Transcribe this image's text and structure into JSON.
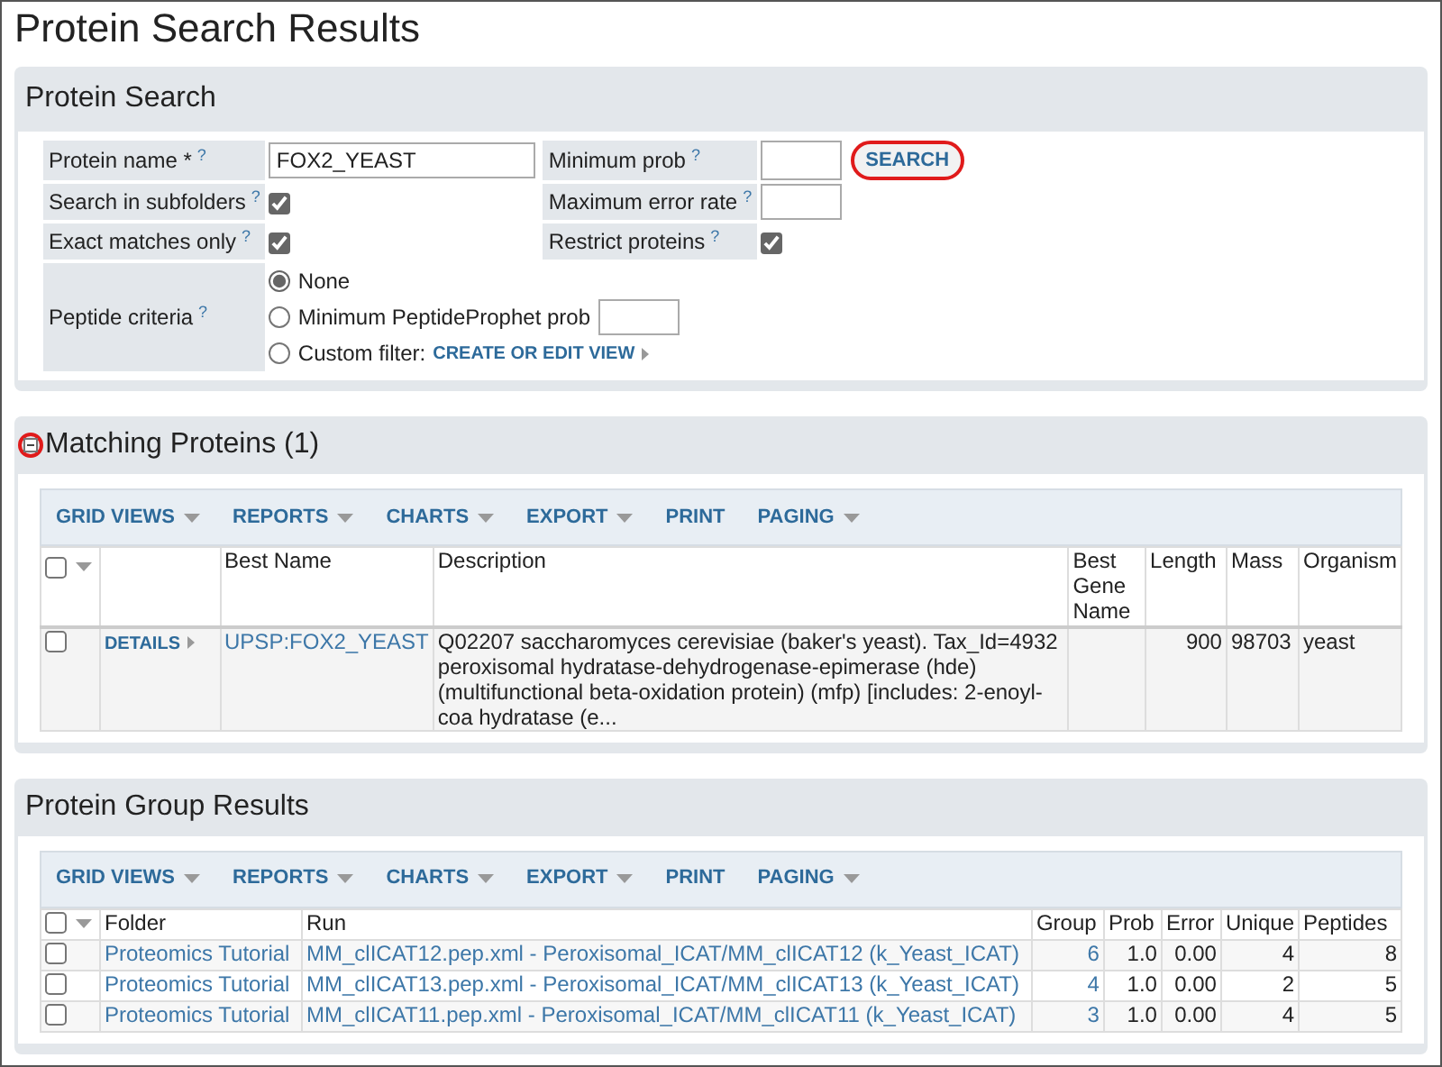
{
  "page_title": "Protein Search Results",
  "protein_search": {
    "title": "Protein Search",
    "protein_name": {
      "label": "Protein name *",
      "help": "?",
      "value": "FOX2_YEAST"
    },
    "minimum_prob": {
      "label": "Minimum prob",
      "help": "?"
    },
    "search_button": {
      "label": "SEARCH",
      "highlighted": true
    },
    "search_in_subfolders": {
      "label": "Search in subfolders",
      "help": "?",
      "checked": true
    },
    "maximum_error_rate": {
      "label": "Maximum error rate",
      "help": "?"
    },
    "exact_matches_only": {
      "label": "Exact matches only",
      "help": "?",
      "checked": true
    },
    "restrict_proteins": {
      "label": "Restrict proteins",
      "help": "?",
      "checked": true
    },
    "peptide_criteria": {
      "label": "Peptide criteria",
      "help": "?",
      "options": [
        {
          "kind": "plain",
          "label": "None",
          "selected": true
        },
        {
          "kind": "input",
          "label": "Minimum PeptideProphet prob",
          "selected": false
        },
        {
          "kind": "link",
          "label": "Custom filter:",
          "link": "CREATE OR EDIT VIEW",
          "selected": false
        }
      ]
    }
  },
  "matching_proteins": {
    "title": "Matching Proteins (1)",
    "collapse_highlighted": true,
    "header_checked": false,
    "toolbar": [
      {
        "label": "GRID VIEWS",
        "has_menu": true
      },
      {
        "label": "REPORTS",
        "has_menu": true
      },
      {
        "label": "CHARTS",
        "has_menu": true
      },
      {
        "label": "EXPORT",
        "has_menu": true
      },
      {
        "label": "PRINT",
        "has_menu": false
      },
      {
        "label": "PAGING",
        "has_menu": true
      }
    ],
    "columns": [
      "Best Name",
      "Description",
      "Best Gene Name",
      "Length",
      "Mass",
      "Organism"
    ],
    "rows": [
      {
        "checked": false,
        "details": "DETAILS",
        "best_name": "UPSP:FOX2_YEAST",
        "description": "Q02207 saccharomyces cerevisiae (baker's yeast). Tax_Id=4932 peroxisomal hydratase-dehydrogenase-epimerase (hde) (multifunctional beta-oxidation protein) (mfp) [includes: 2-enoyl-coa hydratase (e...",
        "length": "900",
        "mass": "98703",
        "organism": "yeast"
      }
    ]
  },
  "protein_group_results": {
    "title": "Protein Group Results",
    "header_checked": false,
    "toolbar": [
      {
        "label": "GRID VIEWS",
        "has_menu": true
      },
      {
        "label": "REPORTS",
        "has_menu": true
      },
      {
        "label": "CHARTS",
        "has_menu": true
      },
      {
        "label": "EXPORT",
        "has_menu": true
      },
      {
        "label": "PRINT",
        "has_menu": false
      },
      {
        "label": "PAGING",
        "has_menu": true
      }
    ],
    "columns": [
      "Folder",
      "Run",
      "Group",
      "Prob",
      "Error",
      "Unique",
      "Peptides"
    ],
    "rows": [
      {
        "checked": false,
        "folder": "Proteomics Tutorial",
        "run": "MM_clICAT12.pep.xml - Peroxisomal_ICAT/MM_clICAT12 (k_Yeast_ICAT)",
        "group": "6",
        "prob": "1.0",
        "error": "0.00",
        "unique": "4",
        "peptides": "8"
      },
      {
        "checked": false,
        "folder": "Proteomics Tutorial",
        "run": "MM_clICAT13.pep.xml - Peroxisomal_ICAT/MM_clICAT13 (k_Yeast_ICAT)",
        "group": "4",
        "prob": "1.0",
        "error": "0.00",
        "unique": "2",
        "peptides": "5"
      },
      {
        "checked": false,
        "folder": "Proteomics Tutorial",
        "run": "MM_clICAT11.pep.xml - Peroxisomal_ICAT/MM_clICAT11 (k_Yeast_ICAT)",
        "group": "3",
        "prob": "1.0",
        "error": "0.00",
        "unique": "4",
        "peptides": "5"
      }
    ]
  }
}
